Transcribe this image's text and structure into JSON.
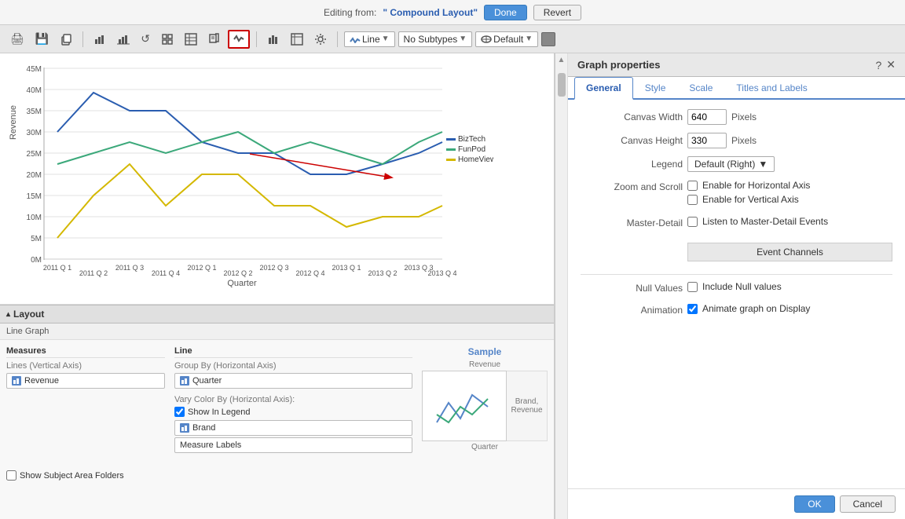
{
  "editing_bar": {
    "label": "Editing from:",
    "layout_name": "\" Compound Layout\"",
    "done_label": "Done",
    "revert_label": "Revert"
  },
  "toolbar": {
    "line_label": "Line",
    "subtypes_label": "No Subtypes",
    "default_label": "Default"
  },
  "chart": {
    "y_axis_label": "Revenue",
    "y_ticks": [
      "45M",
      "40M",
      "35M",
      "30M",
      "25M",
      "20M",
      "15M",
      "10M",
      "5M",
      "0M"
    ],
    "x_ticks": [
      "2011 Q 1",
      "2011 Q 2",
      "2011 Q 3",
      "2011 Q 4",
      "2012 Q 1",
      "2012 Q 2",
      "2012 Q 3",
      "2012 Q 4",
      "2013 Q 1",
      "2013 Q 2",
      "2013 Q 3",
      "2013 Q 4"
    ],
    "x_axis_label": "Quarter",
    "legend": [
      {
        "color": "#2a5db0",
        "label": "BizTech"
      },
      {
        "color": "#3ba87a",
        "label": "FunPod"
      },
      {
        "color": "#d4b800",
        "label": "HomeView"
      }
    ]
  },
  "layout": {
    "header": "Layout",
    "subheader": "Line Graph",
    "measures_header": "Measures",
    "line_header": "Line",
    "lines_vertical": "Lines (Vertical Axis)",
    "revenue_item": "Revenue",
    "group_by_horizontal": "Group By (Horizontal Axis)",
    "quarter_item": "Quarter",
    "vary_color_title": "Vary Color By (Horizontal Axis):",
    "show_in_legend_label": "Show In Legend",
    "brand_item": "Brand",
    "measure_labels_item": "Measure Labels",
    "sample_title": "Sample",
    "sample_y_label": "Revenue",
    "sample_x_label": "Quarter",
    "sample_legend_label": "Brand, Revenue",
    "show_folders_label": "Show Subject Area Folders"
  },
  "graph_properties": {
    "title": "Graph properties",
    "tabs": [
      "General",
      "Style",
      "Scale",
      "Titles and Labels"
    ],
    "active_tab": "General",
    "canvas_width_label": "Canvas Width",
    "canvas_width_value": "640",
    "canvas_height_label": "Canvas Height",
    "canvas_height_value": "330",
    "pixels_label": "Pixels",
    "legend_label": "Legend",
    "legend_value": "Default (Right)",
    "zoom_scroll_label": "Zoom and Scroll",
    "enable_horizontal_label": "Enable for Horizontal Axis",
    "enable_vertical_label": "Enable for Vertical Axis",
    "master_detail_label": "Master-Detail",
    "listen_master_detail_label": "Listen to Master-Detail Events",
    "event_channels_label": "Event Channels",
    "null_values_label": "Null Values",
    "include_null_label": "Include Null values",
    "animation_label": "Animation",
    "animate_graph_label": "Animate graph on Display",
    "ok_label": "OK",
    "cancel_label": "Cancel"
  }
}
